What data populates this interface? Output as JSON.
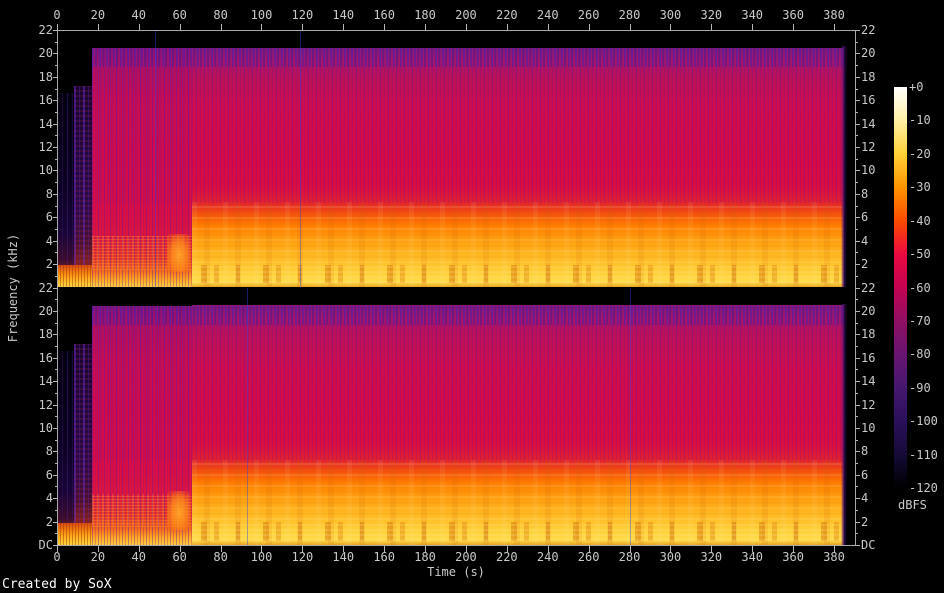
{
  "app": {
    "creator_label": "Created by SoX"
  },
  "chart_data": {
    "type": "heatmap",
    "subtype": "audio-spectrogram",
    "generator": "SoX",
    "title": "",
    "xlabel": "Time (s)",
    "ylabel": "Frequency (kHz)",
    "x_ticks": [
      0,
      20,
      40,
      60,
      80,
      100,
      120,
      140,
      160,
      180,
      200,
      220,
      240,
      260,
      280,
      300,
      320,
      340,
      360,
      380
    ],
    "x_range_s": [
      0,
      390
    ],
    "y_ticks_khz": [
      22,
      20,
      18,
      16,
      14,
      12,
      10,
      8,
      6,
      4,
      2
    ],
    "y_minor_ticks_khz": [
      21,
      19,
      17,
      15,
      13,
      11,
      9,
      7,
      5,
      3,
      1
    ],
    "y_bottom_label": "DC",
    "y_range_khz": [
      0,
      22
    ],
    "channels": 2,
    "grid": false,
    "legend": {
      "label": "dBFS",
      "position": "right",
      "ticks": [
        "+0",
        "-10",
        "-20",
        "-30",
        "-40",
        "-50",
        "-60",
        "-70",
        "-80",
        "-90",
        "-100",
        "-110",
        "-120"
      ],
      "colors": [
        "#ffffff",
        "#fff0a6",
        "#ffd237",
        "#ff9400",
        "#fb4b00",
        "#ec0a40",
        "#c40252",
        "#8f0f63",
        "#681571",
        "#45176f",
        "#2a105a",
        "#150a38",
        "#000000"
      ]
    },
    "palette": {
      "background": "#000000",
      "axis": "#a9a9a9",
      "tick_text": "#c9c9c9",
      "hot_red": "#d40947",
      "stripe_purple": "#5a1ca2",
      "band_orange": "#ff9d0e",
      "band_yellow": "#ffd33e"
    },
    "content": {
      "audio_end_s": 384.5,
      "lowpass_edge_khz": 20.5,
      "layers": [
        {
          "style": "intro-dark",
          "name": "quiet-intro",
          "t": [
            0,
            8.3
          ],
          "f": [
            0,
            16.6
          ]
        },
        {
          "style": "intro-purple",
          "name": "intro-buildup",
          "t": [
            8.3,
            17
          ],
          "f": [
            0,
            17.2
          ]
        },
        {
          "style": "early-red",
          "name": "first-section",
          "t": [
            17,
            66
          ],
          "f": [
            0,
            20.45
          ]
        },
        {
          "style": "main-body",
          "name": "full-mix",
          "t": [
            66,
            384.8
          ],
          "f": [
            0,
            20.5
          ]
        },
        {
          "style": "intro-bottom",
          "name": "intro-bass",
          "t": [
            0,
            17
          ],
          "f": [
            0,
            1.9
          ]
        },
        {
          "style": "early-speckle",
          "name": "first-section-lows",
          "t": [
            17,
            66
          ],
          "f": [
            1.5,
            4.4
          ]
        },
        {
          "style": "orange-blob",
          "name": "pre-section-swell",
          "t": [
            54,
            65.5
          ],
          "f": [
            1.3,
            4.6
          ]
        },
        {
          "style": "stripes-red",
          "name": "harmonic-striping",
          "t": [
            17,
            384.8
          ],
          "f": [
            7.2,
            20.4
          ]
        },
        {
          "style": "stripes-top",
          "name": "top-band-striping",
          "t": [
            17,
            384.8
          ],
          "f": [
            18.8,
            20.45
          ]
        },
        {
          "style": "columns",
          "name": "beat-columns",
          "t": [
            66,
            384.8
          ],
          "f": [
            0,
            7.3
          ]
        },
        {
          "style": "rows",
          "name": "harmonic-rows",
          "t": [
            66,
            384.8
          ],
          "f": [
            2.1,
            7.1
          ]
        },
        {
          "style": "glyphs",
          "name": "bass-note-glyphs",
          "t": [
            66,
            384.8
          ],
          "f": [
            0.35,
            1.95
          ]
        },
        {
          "style": "end-fade",
          "name": "fade-out",
          "t": [
            383.5,
            386.8
          ],
          "f": [
            0,
            20.6
          ]
        },
        {
          "style": "end-black",
          "name": "post-audio-gap",
          "t": [
            386.8,
            390.3
          ],
          "f": [
            0,
            22
          ]
        }
      ],
      "channel_markers_s": [
        [
          48,
          119
        ],
        [
          93,
          280
        ]
      ]
    }
  }
}
